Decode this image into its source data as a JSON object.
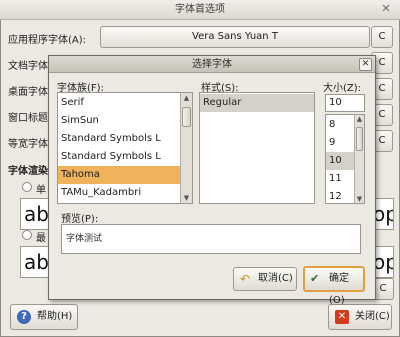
{
  "window": {
    "title": "字体首选项"
  },
  "rows": [
    {
      "label": "应用程序字体(A):",
      "value": "Vera Sans Yuan T"
    },
    {
      "label": "文档字体"
    },
    {
      "label": "桌面字体"
    },
    {
      "label": "窗口标题"
    },
    {
      "label": "等宽字体"
    }
  ],
  "rendering": {
    "heading": "字体渲染",
    "option1": "单",
    "option2": "最",
    "sample_text": "abc",
    "sample_tail": "op"
  },
  "buttons": {
    "help": "帮助(H)",
    "close": "关闭(C)",
    "details": "C"
  },
  "dialog": {
    "title": "选择字体",
    "family_label": "字体族(F):",
    "style_label": "样式(S):",
    "size_label": "大小(Z):",
    "families": [
      {
        "name": "Serif",
        "selected": false
      },
      {
        "name": "SimSun",
        "selected": false
      },
      {
        "name": "Standard Symbols L",
        "selected": false
      },
      {
        "name": "Tahoma",
        "selected": true
      },
      {
        "name": "TAMu_Kadambri",
        "selected": false
      }
    ],
    "families_extra": [
      "Standard Symbols L",
      "Standard Symbols L"
    ],
    "styles": [
      {
        "name": "Regular",
        "selected": true
      }
    ],
    "size_value": "10",
    "sizes": [
      {
        "v": "8",
        "selected": false
      },
      {
        "v": "9",
        "selected": false
      },
      {
        "v": "10",
        "selected": true
      },
      {
        "v": "11",
        "selected": false
      },
      {
        "v": "12",
        "selected": false
      }
    ],
    "preview_label": "预览(P):",
    "preview_text": "字体测试",
    "cancel": "取消(C)",
    "ok": "确定(O)"
  }
}
